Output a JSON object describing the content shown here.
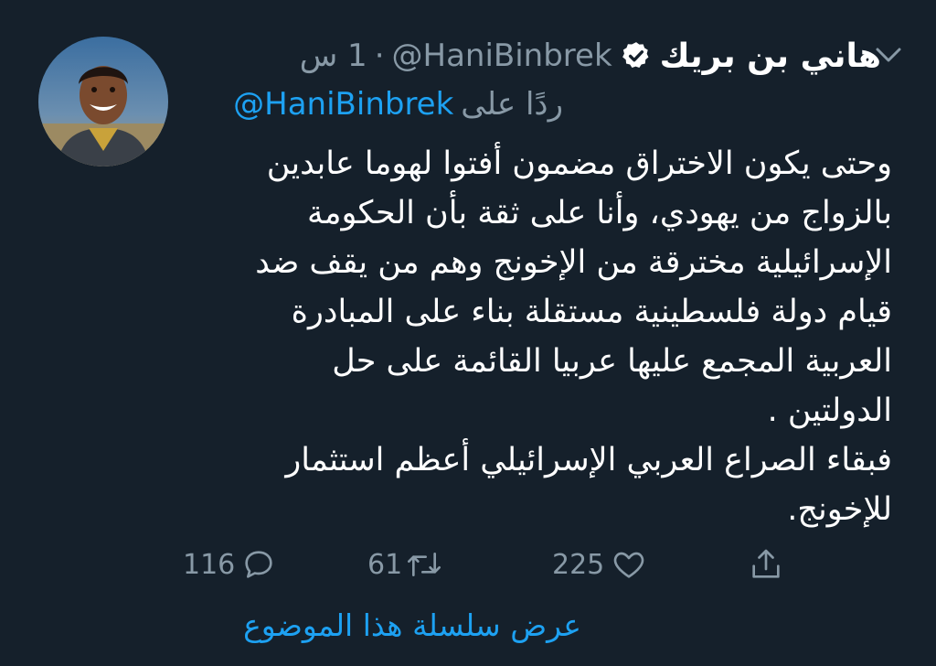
{
  "tweet": {
    "display_name": "هاني بن بريك",
    "handle": "@HaniBinbrek",
    "separator": "·",
    "time": "1 س",
    "reply_prefix": "ردًا على",
    "reply_handle": "@HaniBinbrek",
    "body": "وحتى يكون الاختراق مضمون أفتوا لهوما عابدين\nبالزواج من يهودي، وأنا على ثقة بأن الحكومة\nالإسرائيلية مخترقة من الإخونج وهم من يقف ضد\nقيام دولة فلسطينية مستقلة بناء على المبادرة\nالعربية المجمع عليها عربيا القائمة على حل\nالدولتين .\nفبقاء الصراع العربي الإسرائيلي أعظم استثمار\nللإخونج.",
    "verified": true
  },
  "actions": {
    "reply_count": "116",
    "retweet_count": "61",
    "like_count": "225"
  },
  "thread_link": "عرض سلسلة هذا الموضوع",
  "icons": {
    "verified": "verified-badge-icon",
    "menu": "chevron-down-icon",
    "reply": "reply-icon",
    "retweet": "retweet-icon",
    "like": "heart-icon",
    "share": "share-icon"
  },
  "colors": {
    "background": "#15202b",
    "text": "#ffffff",
    "muted": "#8899a6",
    "accent": "#1da1f2"
  }
}
